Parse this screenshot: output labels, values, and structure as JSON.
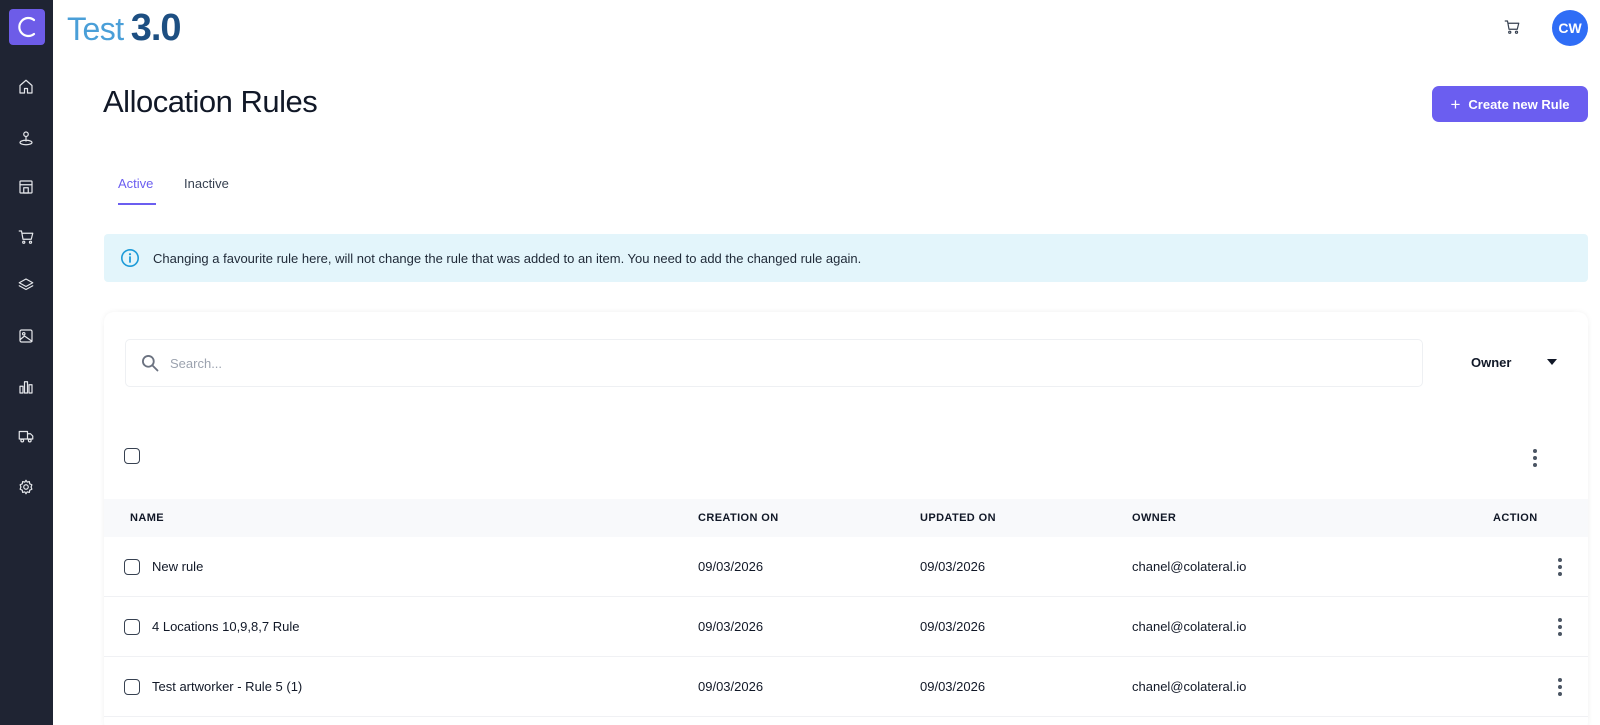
{
  "app": {
    "brand_name": "Test",
    "brand_version": "3.0",
    "logo_letter": "C",
    "user_initials": "CW"
  },
  "sidebar": {
    "items": [
      {
        "icon": "home-icon"
      },
      {
        "icon": "location-icon"
      },
      {
        "icon": "store-icon"
      },
      {
        "icon": "cart-icon"
      },
      {
        "icon": "layers-icon"
      },
      {
        "icon": "image-icon"
      },
      {
        "icon": "bar-chart-icon"
      },
      {
        "icon": "truck-icon"
      },
      {
        "icon": "gear-icon"
      }
    ]
  },
  "page": {
    "title": "Allocation Rules",
    "create_label": "Create new Rule",
    "create_plus": "+"
  },
  "tabs": {
    "active": "Active",
    "inactive": "Inactive"
  },
  "banner": {
    "text": "Changing a favourite rule here, will not change the rule that was added to an item. You need to add the changed rule again."
  },
  "search": {
    "placeholder": "Search..."
  },
  "filter": {
    "owner_label": "Owner"
  },
  "table": {
    "headers": {
      "name": "NAME",
      "creation": "CREATION ON",
      "updated": "UPDATED ON",
      "owner": "OWNER",
      "action": "ACTION"
    },
    "rows": [
      {
        "name": "New rule",
        "creation": "09/03/2026",
        "updated": "09/03/2026",
        "owner": "chanel@colateral.io"
      },
      {
        "name": "4 Locations 10,9,8,7 Rule",
        "creation": "09/03/2026",
        "updated": "09/03/2026",
        "owner": "chanel@colateral.io"
      },
      {
        "name": "Test artworker - Rule 5 (1)",
        "creation": "09/03/2026",
        "updated": "09/03/2026",
        "owner": "chanel@colateral.io"
      }
    ]
  },
  "colors": {
    "accent": "#6b5ef0",
    "sidebar_bg": "#1f2433",
    "banner_bg": "#e3f5fb",
    "avatar_bg": "#2f6df6"
  }
}
